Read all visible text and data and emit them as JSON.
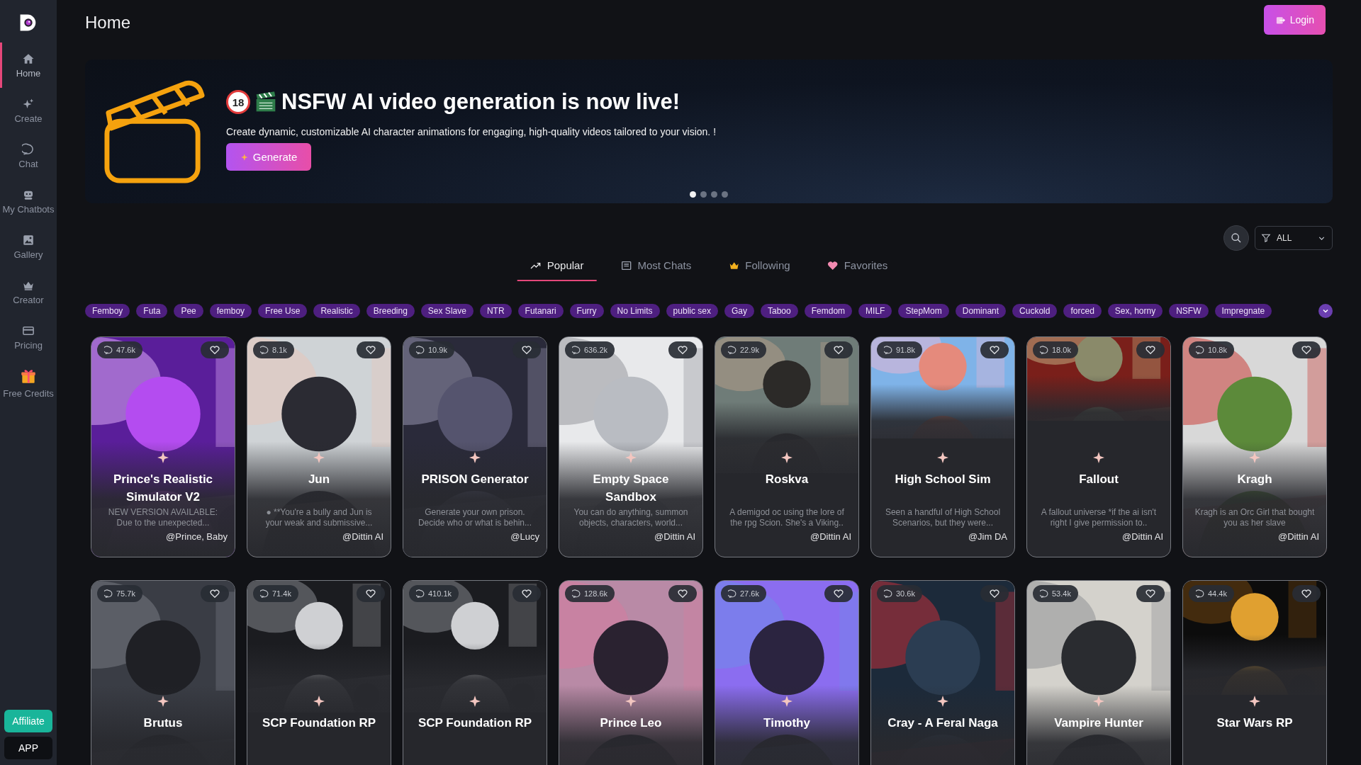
{
  "sidebar": {
    "items": [
      {
        "label": "Home",
        "selected": true
      },
      {
        "label": "Create",
        "selected": false
      },
      {
        "label": "Chat",
        "selected": false
      },
      {
        "label": "My Chatbots",
        "selected": false
      },
      {
        "label": "Gallery",
        "selected": false
      },
      {
        "label": "Creator",
        "selected": false
      },
      {
        "label": "Pricing",
        "selected": false
      },
      {
        "label": "Free Credits",
        "selected": false
      }
    ],
    "buttons": [
      {
        "label": "Affiliate",
        "kind": "affiliate"
      },
      {
        "label": "APP",
        "kind": "app"
      }
    ]
  },
  "header": {
    "title": "Home",
    "login": "Login"
  },
  "banner": {
    "badge": "18",
    "title": "NSFW AI video generation is now live!",
    "text": "Create dynamic, customizable AI character animations for engaging, high-quality videos tailored to your vision. !",
    "button": "Generate",
    "dots": [
      {
        "selected": true
      },
      {
        "selected": false
      },
      {
        "selected": false
      },
      {
        "selected": false
      }
    ]
  },
  "filter": {
    "value": "ALL"
  },
  "tabs": [
    {
      "label": "Popular",
      "selected": true
    },
    {
      "label": "Most Chats",
      "selected": false
    },
    {
      "label": "Following",
      "selected": false
    },
    {
      "label": "Favorites",
      "selected": false
    }
  ],
  "tags": [
    "Femboy",
    "Futa",
    "Pee",
    "femboy",
    "Free Use",
    "Realistic",
    "Breeding",
    "Sex Slave",
    "NTR",
    "Futanari",
    "Furry",
    "No Limits",
    "public sex",
    "Gay",
    "Taboo",
    "Femdom",
    "MILF",
    "StepMom",
    "Dominant",
    "Cuckold",
    "forced",
    "Sex, horny",
    "NSFW",
    "Impregnate"
  ],
  "cards": [
    {
      "chats": "47.6k",
      "title": "Prince's Realistic Simulator V2",
      "description": "NEW VERSION AVAILABLE: Due to the unexpected...",
      "author": "@Prince, Baby"
    },
    {
      "chats": "8.1k",
      "title": "Jun",
      "description": "● **You're a bully and Jun is your weak and submissive...",
      "author": "@Dittin AI"
    },
    {
      "chats": "10.9k",
      "title": "PRISON Generator",
      "description": "Generate your own prison. Decide who or what is behin...",
      "author": "@Lucy"
    },
    {
      "chats": "636.2k",
      "title": "Empty Space Sandbox",
      "description": "You can do anything, summon objects, characters, world...",
      "author": "@Dittin AI"
    },
    {
      "chats": "22.9k",
      "title": "Roskva",
      "description": "A demigod oc using the lore of the rpg Scion. She's a Viking..",
      "author": "@Dittin AI"
    },
    {
      "chats": "91.8k",
      "title": "High School Sim",
      "description": "Seen a handful of High School Scenarios, but they were...",
      "author": "@Jim DA"
    },
    {
      "chats": "18.0k",
      "title": "Fallout",
      "description": "A fallout universe *if the ai isn't right I give permission to..",
      "author": "@Dittin AI"
    },
    {
      "chats": "10.8k",
      "title": "Kragh",
      "description": "Kragh is an Orc Girl that bought you as her slave",
      "author": "@Dittin AI"
    },
    {
      "chats": "75.7k",
      "title": "Brutus"
    },
    {
      "chats": "71.4k",
      "title": "SCP Foundation RP"
    },
    {
      "chats": "410.1k",
      "title": "SCP Foundation RP"
    },
    {
      "chats": "128.6k",
      "title": "Prince Leo"
    },
    {
      "chats": "27.6k",
      "title": "Timothy"
    },
    {
      "chats": "30.6k",
      "title": "Cray - A Feral Naga"
    },
    {
      "chats": "53.4k",
      "title": "Vampire Hunter"
    },
    {
      "chats": "44.4k",
      "title": "Star Wars RP"
    }
  ]
}
